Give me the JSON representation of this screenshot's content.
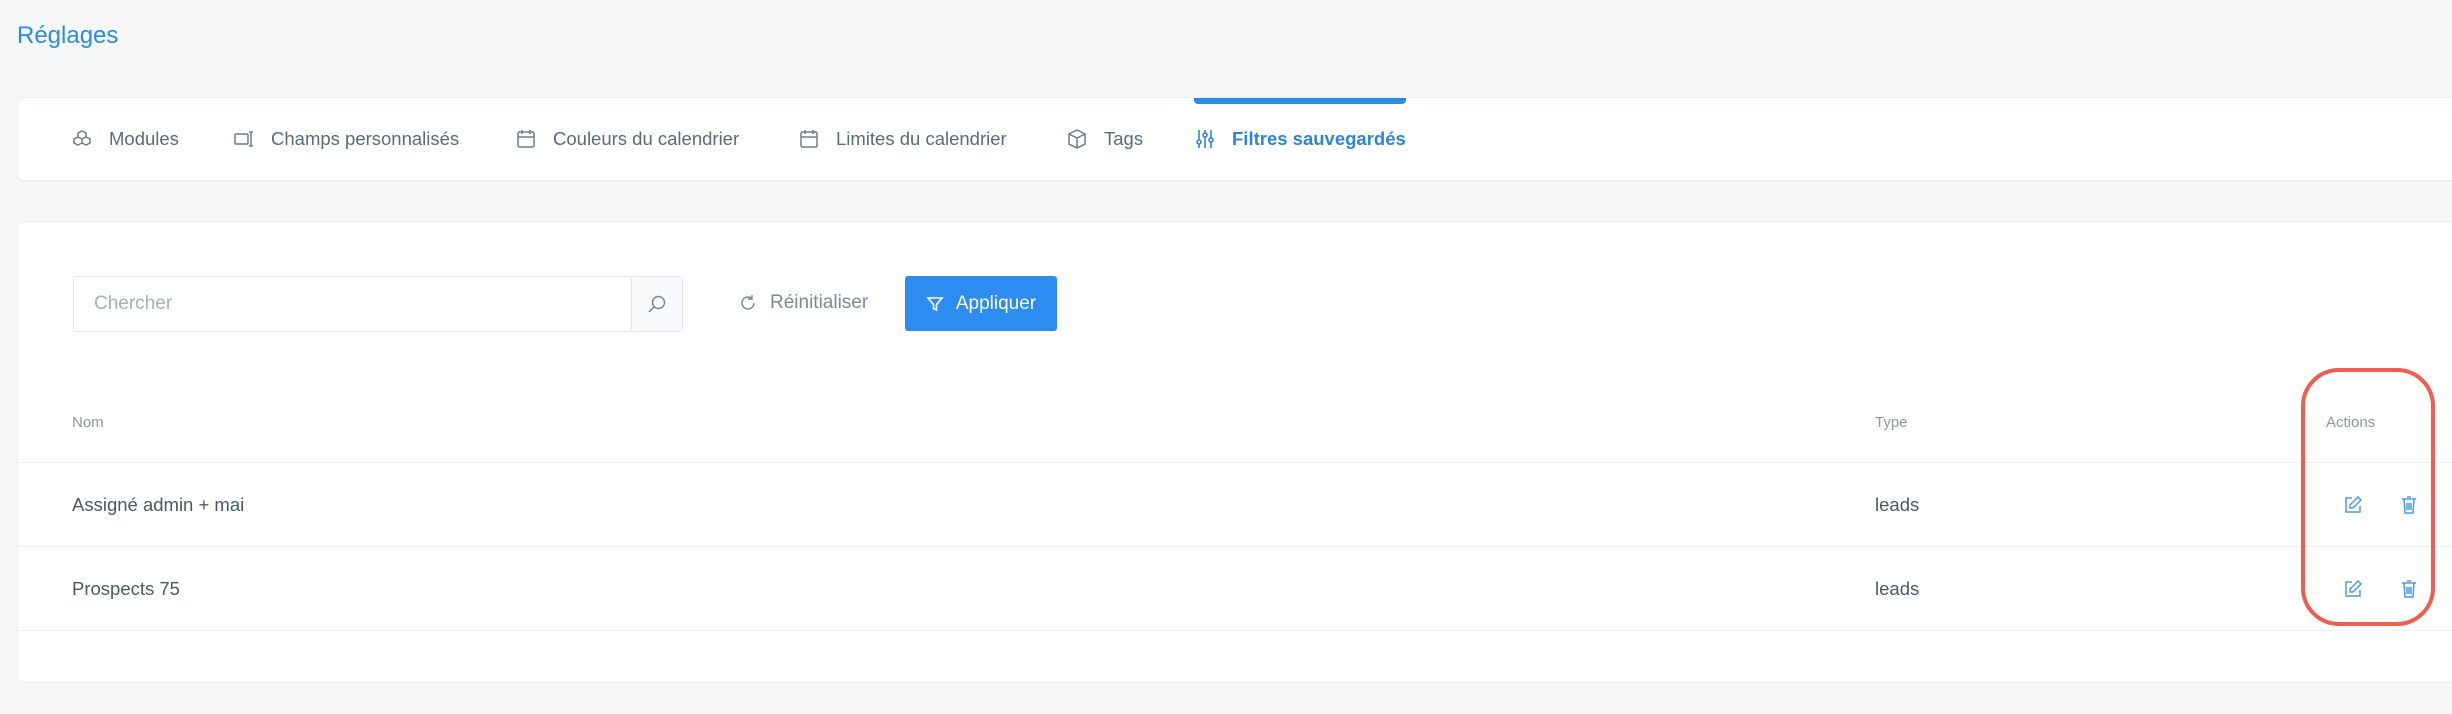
{
  "page": {
    "title": "Réglages"
  },
  "tabs": [
    {
      "label": "Modules",
      "icon": "cubes-icon",
      "active": false
    },
    {
      "label": "Champs personnalisés",
      "icon": "custom-fields-icon",
      "active": false
    },
    {
      "label": "Couleurs du calendrier",
      "icon": "calendar-icon",
      "active": false
    },
    {
      "label": "Limites du calendrier",
      "icon": "calendar-icon",
      "active": false
    },
    {
      "label": "Tags",
      "icon": "box-icon",
      "active": false
    },
    {
      "label": "Filtres sauvegardés",
      "icon": "sliders-icon",
      "active": true
    }
  ],
  "toolbar": {
    "search_placeholder": "Chercher",
    "search_value": "",
    "reset_label": "Réinitialiser",
    "apply_label": "Appliquer"
  },
  "table": {
    "columns": {
      "name": "Nom",
      "type": "Type",
      "actions": "Actions"
    },
    "rows": [
      {
        "name": "Assigné admin + mai",
        "type": "leads"
      },
      {
        "name": "Prospects 75",
        "type": "leads"
      }
    ]
  },
  "colors": {
    "accent": "#2d8cf0",
    "title": "#2b8be6",
    "highlight": "#ee5d50"
  }
}
